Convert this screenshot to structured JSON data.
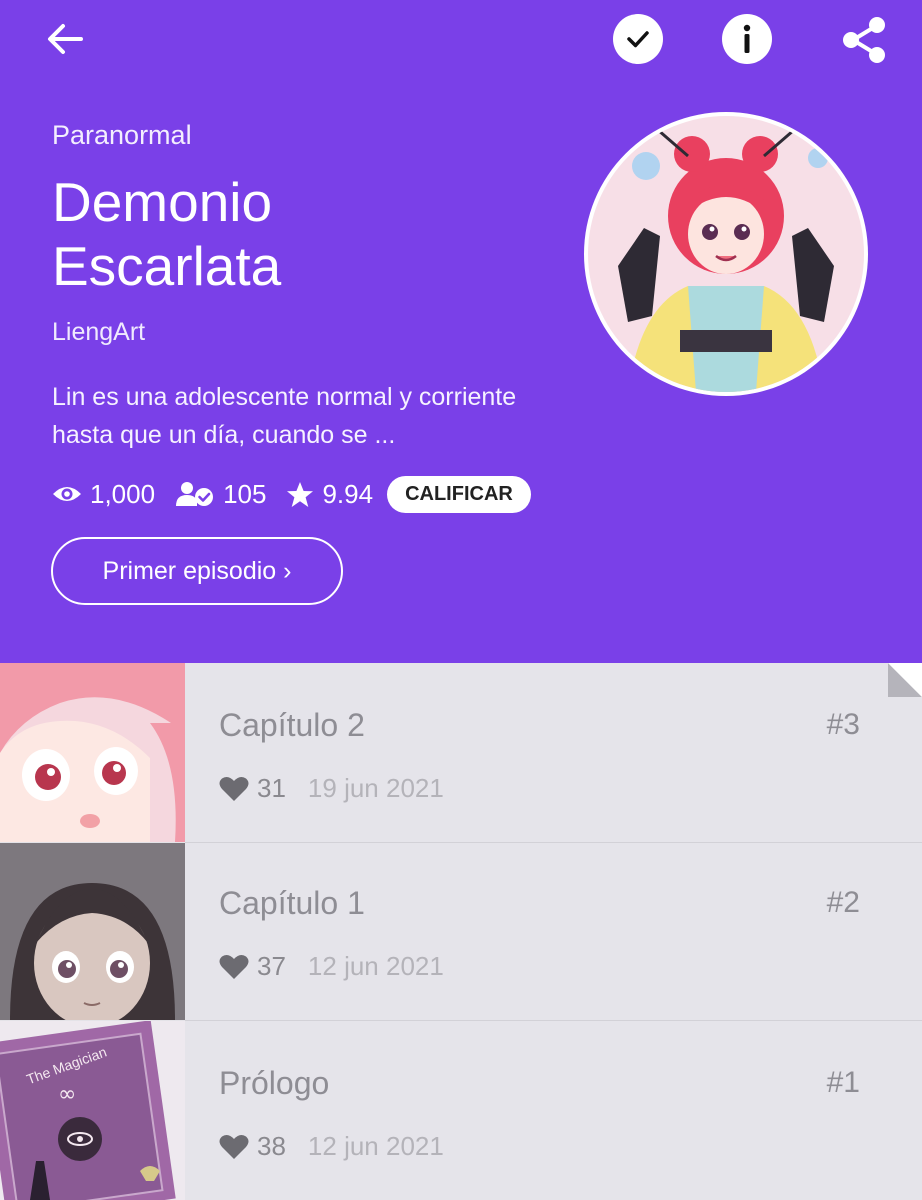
{
  "toolbar": {
    "back_icon": "back-arrow-icon",
    "subscribe_icon": "checkmark-icon",
    "info_icon": "info-icon",
    "share_icon": "share-icon"
  },
  "series": {
    "genre": "Paranormal",
    "title": "Demonio Escarlata",
    "author": "LiengArt",
    "description": "Lin es una adolescente normal y corriente hasta que un día, cuando se ...",
    "views": "1,000",
    "subscribers": "105",
    "rating": "9.94",
    "rate_label": "CALIFICAR",
    "first_episode_label": "Primer episodio ›"
  },
  "episodes": [
    {
      "title": "Capítulo 2",
      "number": "#3",
      "likes": "31",
      "date": "19 jun 2021"
    },
    {
      "title": "Capítulo 1",
      "number": "#2",
      "likes": "37",
      "date": "12 jun 2021"
    },
    {
      "title": "Prólogo",
      "number": "#1",
      "likes": "38",
      "date": "12 jun 2021"
    }
  ],
  "thumbnail_text": {
    "prologue_card": "The Magician"
  },
  "colors": {
    "header_bg": "#7a40e8",
    "list_bg": "#e5e4ea"
  }
}
